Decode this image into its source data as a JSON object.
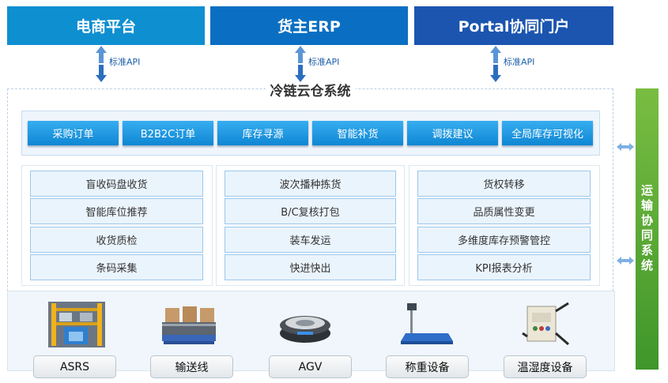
{
  "top_systems": [
    "电商平台",
    "货主ERP",
    "Portal协同门户"
  ],
  "api_label": "标准API",
  "main_title": "冷链云仓系统",
  "functions": [
    "采购订单",
    "B2B2C订单",
    "库存寻源",
    "智能补货",
    "调拨建议",
    "全局库存可视化"
  ],
  "columns": [
    [
      "盲收码盘收货",
      "智能库位推荐",
      "收货质检",
      "条码采集"
    ],
    [
      "波次播种拣货",
      "B/C复核打包",
      "装车发运",
      "快进快出"
    ],
    [
      "货权转移",
      "品质属性变更",
      "多维度库存预警管控",
      "KPI报表分析"
    ]
  ],
  "devices": [
    "ASRS",
    "输送线",
    "AGV",
    "称重设备",
    "温湿度设备"
  ],
  "side_system": "运输协同系统",
  "colors": {
    "top_1": "#0e8fd0",
    "top_2": "#0a6fc2",
    "top_3": "#1b55b0",
    "function_button": "#1a95dd",
    "side_bar": "#5aa834",
    "arrow": "#2c6fc0"
  },
  "icons": [
    "bidirectional-arrow-icon",
    "asrs-rack-image",
    "conveyor-image",
    "agv-robot-image",
    "weighing-scale-image",
    "sensor-box-image"
  ]
}
